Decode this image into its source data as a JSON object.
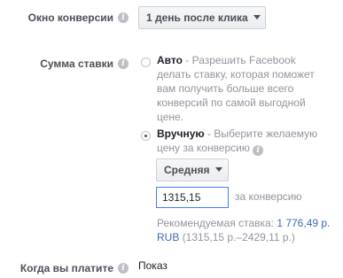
{
  "conversion_window": {
    "label": "Окно конверсии",
    "value": "1 день после клика",
    "icon": "info-icon"
  },
  "bid_amount": {
    "label": "Сумма ставки",
    "icon": "info-icon",
    "auto": {
      "title": "Авто",
      "description": " - Разрешить Facebook делать ставку, которая поможет вам получить больше всего конверсий по самой выгодной цене.",
      "selected": false
    },
    "manual": {
      "title": "Вручную",
      "description": " - Выберите желаемую цену за конверсию",
      "icon": "info-icon",
      "selected": true,
      "level": "Средняя",
      "bid_value": "1315,15",
      "per_conversion": "за конверсию",
      "recommended_prefix": "Рекомендуемая ставка: ",
      "recommended_value": "1 776,49 р. RUB",
      "recommended_range": "(1315,15 р.–2429,11 р.)"
    }
  },
  "when_you_pay": {
    "label": "Когда вы платите",
    "icon": "info-icon",
    "value": "Показ"
  }
}
